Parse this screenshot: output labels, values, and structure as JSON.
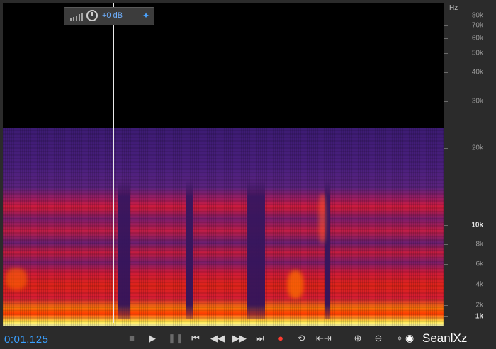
{
  "gain": {
    "value": "+0 dB",
    "icons": [
      "signal-bars-icon",
      "knob-icon",
      "pin-icon"
    ]
  },
  "freq_axis": {
    "unit": "Hz",
    "labels": [
      {
        "text": "80k",
        "bold": false
      },
      {
        "text": "70k",
        "bold": false
      },
      {
        "text": "60k",
        "bold": false
      },
      {
        "text": "50k",
        "bold": false
      },
      {
        "text": "40k",
        "bold": false
      },
      {
        "text": "30k",
        "bold": false
      },
      {
        "text": "20k",
        "bold": false
      },
      {
        "text": "10k",
        "bold": true
      },
      {
        "text": "8k",
        "bold": false
      },
      {
        "text": "6k",
        "bold": false
      },
      {
        "text": "4k",
        "bold": false
      },
      {
        "text": "2k",
        "bold": false
      },
      {
        "text": "1k",
        "bold": true
      }
    ]
  },
  "transport": {
    "time": "0:01.125",
    "buttons": [
      {
        "name": "stop-button",
        "icon": "■",
        "dim": true
      },
      {
        "name": "play-button",
        "icon": "▶",
        "dim": false
      },
      {
        "name": "pause-button",
        "icon": "❚❚",
        "dim": true
      },
      {
        "name": "skip-start-button",
        "icon": "⏮",
        "dim": false
      },
      {
        "name": "rewind-button",
        "icon": "◀◀",
        "dim": false
      },
      {
        "name": "fast-forward-button",
        "icon": "▶▶",
        "dim": false
      },
      {
        "name": "skip-end-button",
        "icon": "⏭",
        "dim": false
      },
      {
        "name": "record-button",
        "icon": "●",
        "dim": false
      },
      {
        "name": "loop-button",
        "icon": "⟲",
        "dim": false
      },
      {
        "name": "skip-selection-button",
        "icon": "⇤⇥",
        "dim": false
      },
      {
        "name": "zoom-in-time-button",
        "icon": "⊕",
        "dim": false
      },
      {
        "name": "zoom-out-time-button",
        "icon": "⊖",
        "dim": false
      },
      {
        "name": "zoom-selection-button",
        "icon": "⌖",
        "dim": false
      }
    ]
  },
  "watermark": {
    "text": "SeanlXz",
    "icon": "weibo-icon"
  },
  "colors": {
    "accent": "#3aa0ff",
    "record": "#ff3b30",
    "background": "#2b2b2b",
    "spectrogram_bg": "#000000"
  }
}
